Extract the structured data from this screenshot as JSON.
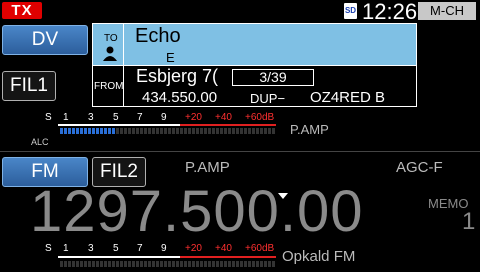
{
  "status_bar": {
    "tx": "TX",
    "sd": "SD",
    "clock": "12:26",
    "mode_badge": "M-CH"
  },
  "buttons": {
    "dv": "DV",
    "fil1": "FIL1",
    "fm": "FM",
    "fil2": "FIL2"
  },
  "call_panel": {
    "to_label": "TO",
    "to_value": "Echo",
    "to_sub": "E",
    "from_label": "FROM",
    "from_value": "Esbjerg 7(",
    "counter": "3/39",
    "frequency": "434.550.00",
    "dup": "DUP−",
    "callsign": "OZ4RED B"
  },
  "meter1": {
    "scale_white": [
      "S",
      "1",
      "3",
      "5",
      "7",
      "9"
    ],
    "scale_red": [
      "+20",
      "+40",
      "+60dB"
    ],
    "alc": "ALC",
    "pamp": "P.AMP"
  },
  "middle": {
    "pamp": "P.AMP",
    "agc": "AGC-F"
  },
  "main_freq": {
    "value": "1297.500.00",
    "memo_label": "MEMO",
    "memo_value": "1"
  },
  "meter2": {
    "scale_white": [
      "S",
      "1",
      "3",
      "5",
      "7",
      "9"
    ],
    "scale_red": [
      "+20",
      "+40",
      "+60dB"
    ],
    "name": "Opkald FM"
  },
  "colors": {
    "tx": "#e00000",
    "panel": "#7fc0e4",
    "button": "#2c5e9c",
    "meter_bar": "#2a6fd8"
  }
}
